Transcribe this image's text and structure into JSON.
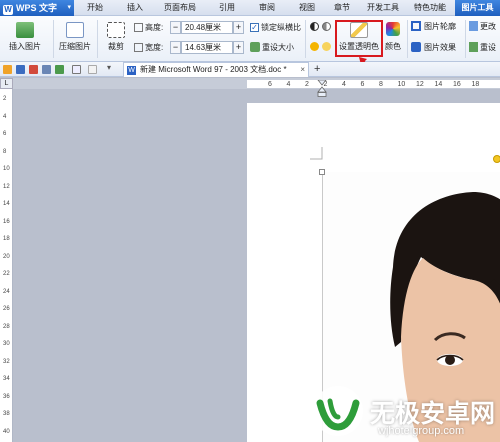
{
  "app": {
    "logo_text": "WPS 文字",
    "dropdown_glyph": "▾"
  },
  "tabs": [
    {
      "label": "开始"
    },
    {
      "label": "插入"
    },
    {
      "label": "页面布局"
    },
    {
      "label": "引用"
    },
    {
      "label": "审阅"
    },
    {
      "label": "视图"
    },
    {
      "label": "章节"
    },
    {
      "label": "开发工具"
    },
    {
      "label": "特色功能"
    },
    {
      "label": "图片工具",
      "active": true
    }
  ],
  "ribbon": {
    "insert_picture": "插入图片",
    "compress_picture": "压缩图片",
    "crop": "裁剪",
    "height_label": "高度:",
    "height_value": "20.48厘米",
    "width_label": "宽度:",
    "width_value": "14.63厘米",
    "lock_aspect": "锁定纵横比",
    "reset_size": "重设大小",
    "set_transparent": "设置透明色",
    "color": "颜色",
    "picture_outline": "图片轮廓",
    "picture_effect": "图片效果",
    "change_picture": "更改",
    "reset": "重设",
    "minus": "−",
    "plus": "+",
    "check": "✓"
  },
  "doc_tab": {
    "title": "新建 Microsoft Word 97 - 2003 文档.doc *",
    "close": "×",
    "new_tab": "+"
  },
  "ruler": {
    "corner": "L",
    "h_ticks": [
      "6",
      "4",
      "2",
      "2",
      "4",
      "6",
      "8",
      "10",
      "12",
      "14",
      "16",
      "18"
    ],
    "v_ticks": [
      "2",
      "4",
      "6",
      "8",
      "10",
      "12",
      "14",
      "16",
      "18",
      "20",
      "22",
      "24",
      "26",
      "28",
      "30",
      "32",
      "34",
      "36",
      "38",
      "40"
    ]
  },
  "watermark": {
    "title": "无极安卓网",
    "url": "wjhotelgroup.com"
  },
  "colors": {
    "accent": "#1f5fbf",
    "highlight": "#d8191e",
    "watermark_green": "#2e9d3a"
  }
}
